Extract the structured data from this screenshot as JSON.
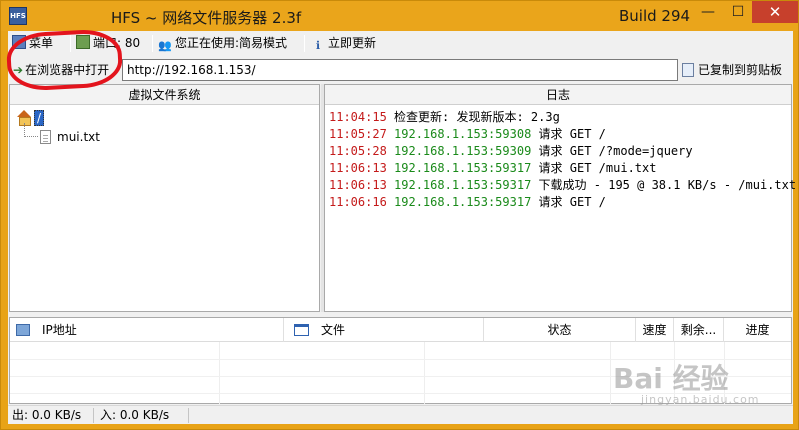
{
  "window": {
    "title": "HFS ~ 网络文件服务器 2.3f",
    "build": "Build 294",
    "icon_text": "HFS",
    "minimize": "—",
    "maximize": "☐",
    "close": "✕"
  },
  "toolbar": {
    "menu_label": "菜单",
    "port_label": "端口: 80",
    "mode_label": "您正在使用:简易模式",
    "update_label": "立即更新"
  },
  "urlbar": {
    "open_label": "在浏览器中打开",
    "url_value": "http://192.168.1.153/",
    "copy_status": "已复制到剪贴板"
  },
  "vfs": {
    "header": "虚拟文件系统",
    "root": "/",
    "files": [
      "mui.txt"
    ]
  },
  "log": {
    "header": "日志",
    "lines": [
      {
        "time": "11:04:15",
        "ip": "",
        "msg": "检查更新: 发现新版本: 2.3g"
      },
      {
        "time": "11:05:27",
        "ip": "192.168.1.153:59308",
        "msg": "请求 GET /"
      },
      {
        "time": "11:05:28",
        "ip": "192.168.1.153:59309",
        "msg": "请求 GET /?mode=jquery"
      },
      {
        "time": "11:06:13",
        "ip": "192.168.1.153:59317",
        "msg": "请求 GET /mui.txt"
      },
      {
        "time": "11:06:13",
        "ip": "192.168.1.153:59317",
        "msg": "下载成功 - 195 @ 38.1 KB/s - /mui.txt"
      },
      {
        "time": "11:06:16",
        "ip": "192.168.1.153:59317",
        "msg": "请求 GET /"
      }
    ]
  },
  "connections": {
    "columns": [
      "IP地址",
      "文件",
      "状态",
      "速度",
      "剩余...",
      "进度"
    ]
  },
  "statusbar": {
    "out": "出: 0.0 KB/s",
    "in": "入: 0.0 KB/s"
  },
  "watermark": {
    "main": "Bai 经验",
    "sub": "jingyan.baidu.com"
  },
  "colors": {
    "title_bar": "#eaa51b",
    "close_button": "#c7402c",
    "log_time": "#c41a1a",
    "log_ip": "#1a8a1a",
    "annotation": "#e3141d"
  }
}
